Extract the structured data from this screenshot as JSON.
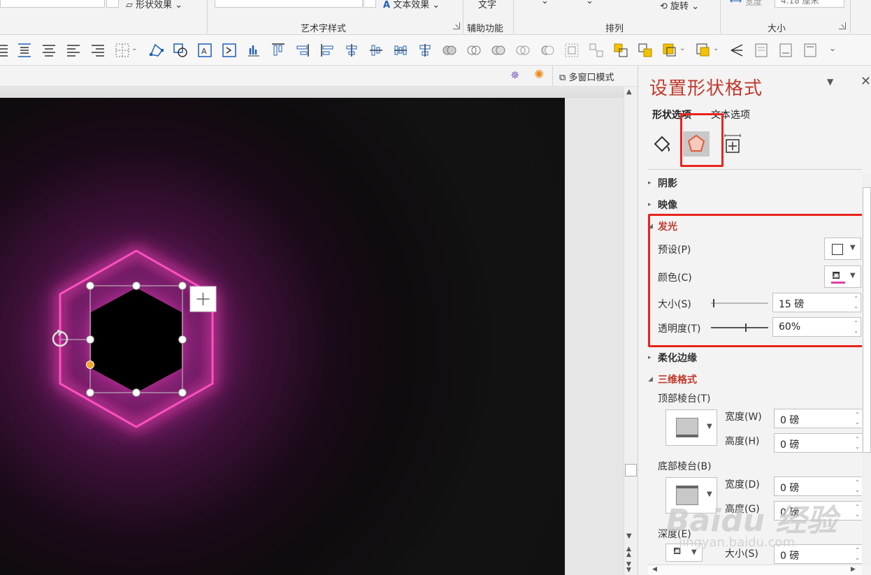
{
  "ribbon": {
    "shape_effects": "形状效果",
    "text_effects": "文本效果",
    "text_label": "文字",
    "rotate": "旋转",
    "width_label": "宽度",
    "width_value": "4.18 厘米",
    "groups": {
      "wordart": "艺术字样式",
      "accessibility": "辅助功能",
      "arrange": "排列",
      "size": "大小"
    }
  },
  "row3": {
    "multi_window": "多窗口模式"
  },
  "pane": {
    "title": "设置形状格式",
    "tabs": {
      "shape": "形状选项",
      "text": "文本选项"
    },
    "sections": {
      "shadow": "阴影",
      "reflection": "映像",
      "glow": "发光",
      "soft_edges": "柔化边缘",
      "format_3d": "三维格式"
    },
    "glow": {
      "preset_label": "预设(P)",
      "color_label": "颜色(C)",
      "color_swatch": "#e040a8",
      "size_label": "大小(S)",
      "size_value": "15 磅",
      "size_fraction": 0.04,
      "transparency_label": "透明度(T)",
      "transparency_value": "60%",
      "transparency_fraction": 0.6
    },
    "format_3d": {
      "top_bevel_label": "顶部棱台(T)",
      "width_label": "宽度(W)",
      "width_value": "0 磅",
      "height_label": "高度(H)",
      "height_value": "0 磅",
      "bottom_bevel_label": "底部棱台(B)",
      "bottom_width_label": "宽度(D)",
      "bottom_width_value": "0 磅",
      "bottom_height_label": "高度(G)",
      "bottom_height_value": "0 磅",
      "depth_label": "深度(E)",
      "depth_size_label": "大小(S)",
      "depth_size_value": "0 磅"
    }
  },
  "watermark": {
    "brand": "Baidu 经验",
    "url": "jingyan.baidu.com"
  },
  "colors": {
    "accent_red": "#c0392b",
    "glow_pink": "#ff4fc0",
    "highlight_box": "#e8241b"
  }
}
